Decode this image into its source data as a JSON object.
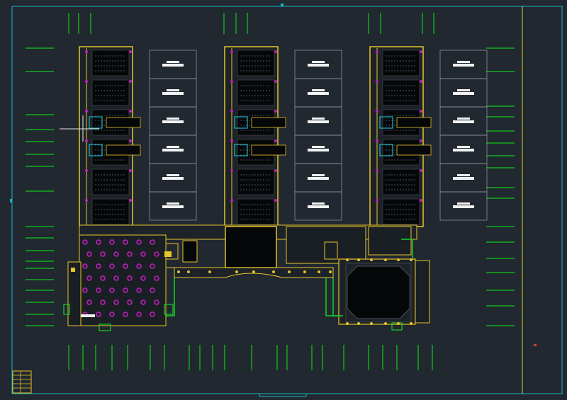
{
  "canvas": {
    "background": "#212830",
    "frame_color": "#19b6c8",
    "titleblock_line_color": "#ddd22a",
    "marker_color": "#d0402c"
  },
  "palette": {
    "parking": "#12c81a",
    "wall": "#e6c42a",
    "column": "#c01ec0",
    "room_line": "#8a93a0",
    "dark_fill": "#050709",
    "dense_fill": "#1a1f24",
    "stair": "#1fb6c6",
    "outline": "#16d126",
    "light_text_bar": "#f2f2f2"
  },
  "drawing": {
    "kind": "cad-floor-plan",
    "classroom_wings": 3,
    "classrooms_per_wing": 6,
    "courtyard_blocks_per_wing": 6,
    "has_auditorium": true,
    "has_dining_hall": true
  }
}
